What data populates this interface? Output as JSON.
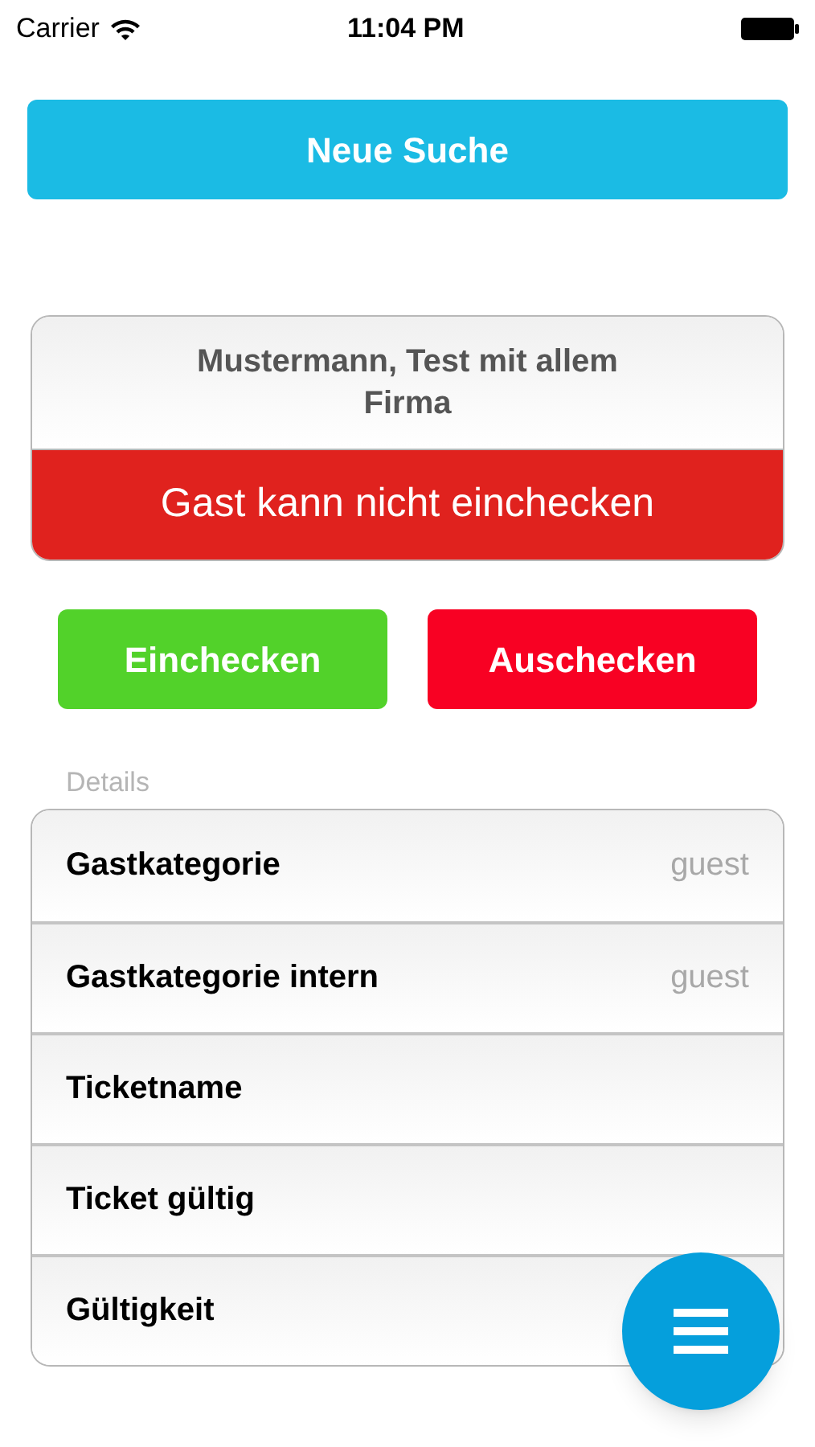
{
  "status_bar": {
    "carrier": "Carrier",
    "time": "11:04 PM"
  },
  "new_search_button": "Neue Suche",
  "guest_card": {
    "name_lines": [
      "Mustermann, Test mit allem",
      "Firma"
    ],
    "status": "Gast kann nicht einchecken"
  },
  "actions": [
    {
      "label": "Einchecken",
      "kind": "checkin"
    },
    {
      "label": "Auschecken",
      "kind": "checkout"
    }
  ],
  "details": {
    "header": "Details",
    "rows": [
      {
        "label": "Gastkategorie",
        "value": "guest"
      },
      {
        "label": "Gastkategorie intern",
        "value": "guest"
      },
      {
        "label": "Ticketname"
      },
      {
        "label": "Ticket gültig"
      },
      {
        "label": "Gültigkeit"
      }
    ]
  }
}
